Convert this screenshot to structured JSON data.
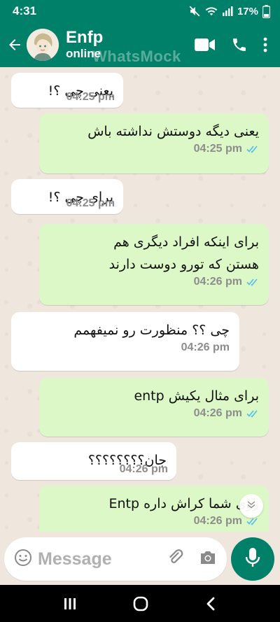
{
  "status_bar": {
    "time": "4:31",
    "battery": "17%",
    "icons": [
      "mute-icon",
      "wifi-icon",
      "signal-icon",
      "battery-icon"
    ]
  },
  "header": {
    "name": "Enfp",
    "status": "online",
    "watermark": "WhatsMock",
    "icons": [
      "back-arrow-icon",
      "avatar",
      "video-call-icon",
      "phone-icon",
      "more-options-icon"
    ]
  },
  "colors": {
    "brand": "#008069",
    "incoming_bubble": "#ffffff",
    "outgoing_bubble": "#dcf8c6",
    "read_tick": "#53bdeb",
    "background": "#efe7de"
  },
  "messages": [
    {
      "dir": "in",
      "text": "یعنی چی ؟!",
      "time": "04:25 pm"
    },
    {
      "dir": "out",
      "text": "یعنی دیگه دوستش نداشته باش",
      "time": "04:25 pm",
      "read": true
    },
    {
      "dir": "in",
      "text": "برای چی ؟!",
      "time": "04:25 pm"
    },
    {
      "dir": "out",
      "text": "برای اینکه افراد دیگری هم\nهستن که تورو دوست دارند",
      "time": "04:26 pm",
      "read": true
    },
    {
      "dir": "in",
      "text": "چی ؟؟ منظورت رو نمیفهمم",
      "time": "04:26 pm"
    },
    {
      "dir": "out",
      "text": "برای مثال یکیش entp",
      "time": "04:26 pm",
      "read": true
    },
    {
      "dir": "in",
      "text": "جان؟؟؟؟؟؟؟؟",
      "time": "04:26 pm"
    },
    {
      "dir": "out",
      "text": "روی شما کراش داره Entp",
      "time": "04:26 pm",
      "read": true
    }
  ],
  "composer": {
    "placeholder": "Message",
    "icons": [
      "emoji-icon",
      "attach-icon",
      "camera-icon",
      "mic-icon"
    ]
  },
  "nav": {
    "icons": [
      "recent-apps-icon",
      "home-icon",
      "back-icon"
    ]
  }
}
